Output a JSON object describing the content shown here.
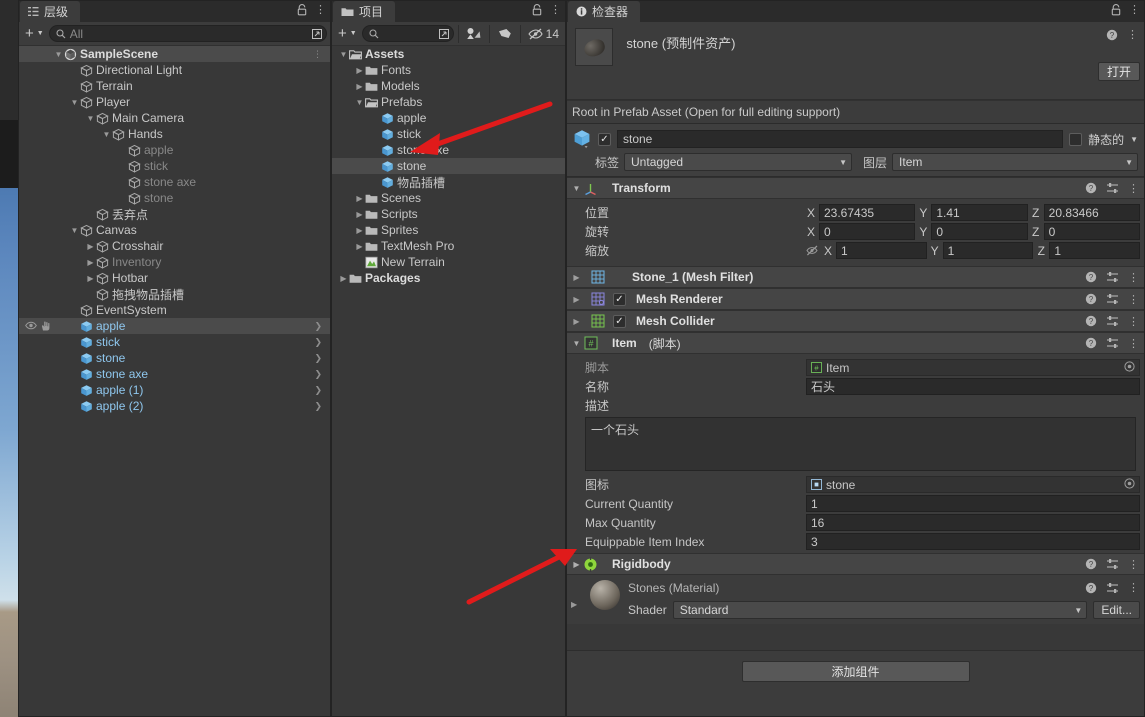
{
  "hierarchy": {
    "tab_label": "层级",
    "tab_icon": "hierarchy-icon",
    "lock_icon": "lock-icon",
    "menu_icon": "kebab-icon",
    "add_label": "+",
    "search_placeholder": "All",
    "items": [
      {
        "label": "SampleScene",
        "depth": 1,
        "arrow": "down",
        "icon": "unity-scene-icon",
        "bold": true,
        "selected": true,
        "dim": false,
        "chevron": false
      },
      {
        "label": "Directional Light",
        "depth": 2,
        "arrow": "none",
        "icon": "gameobject-icon",
        "bold": false,
        "selected": false,
        "dim": false,
        "chevron": false
      },
      {
        "label": "Terrain",
        "depth": 2,
        "arrow": "none",
        "icon": "gameobject-icon",
        "bold": false,
        "selected": false,
        "dim": false,
        "chevron": false
      },
      {
        "label": "Player",
        "depth": 2,
        "arrow": "down",
        "icon": "gameobject-icon",
        "bold": false,
        "selected": false,
        "dim": false,
        "chevron": false
      },
      {
        "label": "Main Camera",
        "depth": 3,
        "arrow": "down",
        "icon": "gameobject-icon",
        "bold": false,
        "selected": false,
        "dim": false,
        "chevron": false
      },
      {
        "label": "Hands",
        "depth": 4,
        "arrow": "down",
        "icon": "gameobject-icon",
        "bold": false,
        "selected": false,
        "dim": false,
        "chevron": false
      },
      {
        "label": "apple",
        "depth": 5,
        "arrow": "none",
        "icon": "gameobject-icon",
        "bold": false,
        "selected": false,
        "dim": true,
        "chevron": false
      },
      {
        "label": "stick",
        "depth": 5,
        "arrow": "none",
        "icon": "gameobject-icon",
        "bold": false,
        "selected": false,
        "dim": true,
        "chevron": false
      },
      {
        "label": "stone axe",
        "depth": 5,
        "arrow": "none",
        "icon": "gameobject-icon",
        "bold": false,
        "selected": false,
        "dim": true,
        "chevron": false
      },
      {
        "label": "stone",
        "depth": 5,
        "arrow": "none",
        "icon": "gameobject-icon",
        "bold": false,
        "selected": false,
        "dim": true,
        "chevron": false
      },
      {
        "label": "丢弃点",
        "depth": 3,
        "arrow": "none",
        "icon": "gameobject-icon",
        "bold": false,
        "selected": false,
        "dim": false,
        "chevron": false
      },
      {
        "label": "Canvas",
        "depth": 2,
        "arrow": "down",
        "icon": "gameobject-icon",
        "bold": false,
        "selected": false,
        "dim": false,
        "chevron": false
      },
      {
        "label": "Crosshair",
        "depth": 3,
        "arrow": "right",
        "icon": "gameobject-icon",
        "bold": false,
        "selected": false,
        "dim": false,
        "chevron": false
      },
      {
        "label": "Inventory",
        "depth": 3,
        "arrow": "right",
        "icon": "gameobject-icon",
        "bold": false,
        "selected": false,
        "dim": true,
        "chevron": false
      },
      {
        "label": "Hotbar",
        "depth": 3,
        "arrow": "right",
        "icon": "gameobject-icon",
        "bold": false,
        "selected": false,
        "dim": false,
        "chevron": false
      },
      {
        "label": "拖拽物品插槽",
        "depth": 3,
        "arrow": "none",
        "icon": "gameobject-icon",
        "bold": false,
        "selected": false,
        "dim": false,
        "chevron": false
      },
      {
        "label": "EventSystem",
        "depth": 2,
        "arrow": "none",
        "icon": "gameobject-icon",
        "bold": false,
        "selected": false,
        "dim": false,
        "chevron": false
      },
      {
        "label": "apple",
        "depth": 2,
        "arrow": "none",
        "icon": "prefab-icon",
        "bold": false,
        "selected": true,
        "dim": false,
        "chevron": true,
        "vis": true
      },
      {
        "label": "stick",
        "depth": 2,
        "arrow": "none",
        "icon": "prefab-icon",
        "bold": false,
        "selected": false,
        "dim": false,
        "chevron": true
      },
      {
        "label": "stone",
        "depth": 2,
        "arrow": "none",
        "icon": "prefab-icon",
        "bold": false,
        "selected": false,
        "dim": false,
        "chevron": true
      },
      {
        "label": "stone axe",
        "depth": 2,
        "arrow": "none",
        "icon": "prefab-icon",
        "bold": false,
        "selected": false,
        "dim": false,
        "chevron": true
      },
      {
        "label": "apple (1)",
        "depth": 2,
        "arrow": "none",
        "icon": "prefab-icon",
        "bold": false,
        "selected": false,
        "dim": false,
        "chevron": true
      },
      {
        "label": "apple (2)",
        "depth": 2,
        "arrow": "none",
        "icon": "prefab-icon",
        "bold": false,
        "selected": false,
        "dim": false,
        "chevron": true
      }
    ]
  },
  "project": {
    "tab_label": "项目",
    "tab_icon": "folder-icon",
    "lock_icon": "lock-icon",
    "menu_icon": "kebab-icon",
    "add_label": "+",
    "search_placeholder": "",
    "toolbar_icons": [
      "save-search-icon",
      "label-icon",
      "hidden-packages-icon"
    ],
    "hidden_count": "14",
    "items": [
      {
        "label": "Assets",
        "depth": 0,
        "arrow": "down",
        "icon": "folder-open-icon",
        "bold": true,
        "selected": false
      },
      {
        "label": "Fonts",
        "depth": 1,
        "arrow": "right",
        "icon": "folder-icon",
        "bold": false,
        "selected": false
      },
      {
        "label": "Models",
        "depth": 1,
        "arrow": "right",
        "icon": "folder-icon",
        "bold": false,
        "selected": false
      },
      {
        "label": "Prefabs",
        "depth": 1,
        "arrow": "down",
        "icon": "folder-open-icon",
        "bold": false,
        "selected": false
      },
      {
        "label": "apple",
        "depth": 2,
        "arrow": "none",
        "icon": "prefab-icon",
        "bold": false,
        "selected": false
      },
      {
        "label": "stick",
        "depth": 2,
        "arrow": "none",
        "icon": "prefab-icon",
        "bold": false,
        "selected": false
      },
      {
        "label": "stone axe",
        "depth": 2,
        "arrow": "none",
        "icon": "prefab-icon",
        "bold": false,
        "selected": false
      },
      {
        "label": "stone",
        "depth": 2,
        "arrow": "none",
        "icon": "prefab-icon",
        "bold": false,
        "selected": true
      },
      {
        "label": "物品插槽",
        "depth": 2,
        "arrow": "none",
        "icon": "prefab-icon",
        "bold": false,
        "selected": false
      },
      {
        "label": "Scenes",
        "depth": 1,
        "arrow": "right",
        "icon": "folder-icon",
        "bold": false,
        "selected": false
      },
      {
        "label": "Scripts",
        "depth": 1,
        "arrow": "right",
        "icon": "folder-icon",
        "bold": false,
        "selected": false
      },
      {
        "label": "Sprites",
        "depth": 1,
        "arrow": "right",
        "icon": "folder-icon",
        "bold": false,
        "selected": false
      },
      {
        "label": "TextMesh Pro",
        "depth": 1,
        "arrow": "right",
        "icon": "folder-icon",
        "bold": false,
        "selected": false
      },
      {
        "label": "New Terrain",
        "depth": 1,
        "arrow": "none",
        "icon": "terrain-icon",
        "bold": false,
        "selected": false
      },
      {
        "label": "Packages",
        "depth": 0,
        "arrow": "right",
        "icon": "folder-icon",
        "bold": true,
        "selected": false
      }
    ]
  },
  "inspector": {
    "tab_label": "检查器",
    "tab_icon": "info-icon",
    "lock_icon": "lock-icon",
    "menu_icon": "kebab-icon",
    "help_icon": "help-icon",
    "asset_title": "stone (预制件资产)",
    "open_button": "打开",
    "prefab_notice": "Root in Prefab Asset (Open for full editing support)",
    "gameobject": {
      "enabled": true,
      "name": "stone",
      "static_label": "静态的",
      "static_checked": false,
      "tag_label": "标签",
      "tag_value": "Untagged",
      "layer_label": "图层",
      "layer_value": "Item"
    },
    "transform": {
      "title": "Transform",
      "icon": "transform-icon",
      "rows": [
        {
          "label": "位置",
          "x": "23.67435",
          "y": "1.41",
          "z": "20.83466",
          "lock": false
        },
        {
          "label": "旋转",
          "x": "0",
          "y": "0",
          "z": "0",
          "lock": false
        },
        {
          "label": "缩放",
          "x": "1",
          "y": "1",
          "z": "1",
          "lock": true
        }
      ],
      "axes": [
        "X",
        "Y",
        "Z"
      ]
    },
    "components": [
      {
        "name": "Stone_1 (Mesh Filter)",
        "icon": "mesh-filter-icon",
        "has_checkbox": false,
        "checked": false,
        "expanded": false
      },
      {
        "name": "Mesh Renderer",
        "icon": "mesh-renderer-icon",
        "has_checkbox": true,
        "checked": true,
        "expanded": false
      },
      {
        "name": "Mesh Collider",
        "icon": "mesh-collider-icon",
        "has_checkbox": true,
        "checked": true,
        "expanded": false
      }
    ],
    "item_component": {
      "title": "Item",
      "title_suffix": "(脚本)",
      "icon": "script-icon",
      "expanded": true,
      "fields": [
        {
          "label": "脚本",
          "type": "object",
          "value": "Item",
          "icon": "script-icon",
          "dim_label": true
        },
        {
          "label": "名称",
          "type": "text",
          "value": "石头"
        },
        {
          "label": "描述",
          "type": "textarea",
          "value": "一个石头"
        },
        {
          "label": "图标",
          "type": "object",
          "value": "stone",
          "icon": "sprite-icon"
        },
        {
          "label": "Current Quantity",
          "type": "text",
          "value": "1"
        },
        {
          "label": "Max Quantity",
          "type": "text",
          "value": "16"
        },
        {
          "label": "Equippable Item Index",
          "type": "text",
          "value": "3"
        }
      ]
    },
    "rigidbody": {
      "name": "Rigidbody",
      "icon": "rigidbody-icon",
      "expanded": false
    },
    "material": {
      "title": "Stones (Material)",
      "shader_label": "Shader",
      "shader_value": "Standard",
      "edit_button": "Edit..."
    },
    "add_component_button": "添加组件"
  },
  "annotations": {
    "arrow_color": "#e01b1b",
    "arrows": [
      {
        "name": "arrow-to-stick-prefab"
      },
      {
        "name": "arrow-to-equippable-item-index"
      }
    ]
  },
  "colors": {
    "panel_bg": "#383838",
    "header_bg": "#3c3c3c",
    "selection": "#4b4b4b",
    "prefab_blue": "#8fc7ee",
    "window_bg": "#2b2b2b"
  }
}
